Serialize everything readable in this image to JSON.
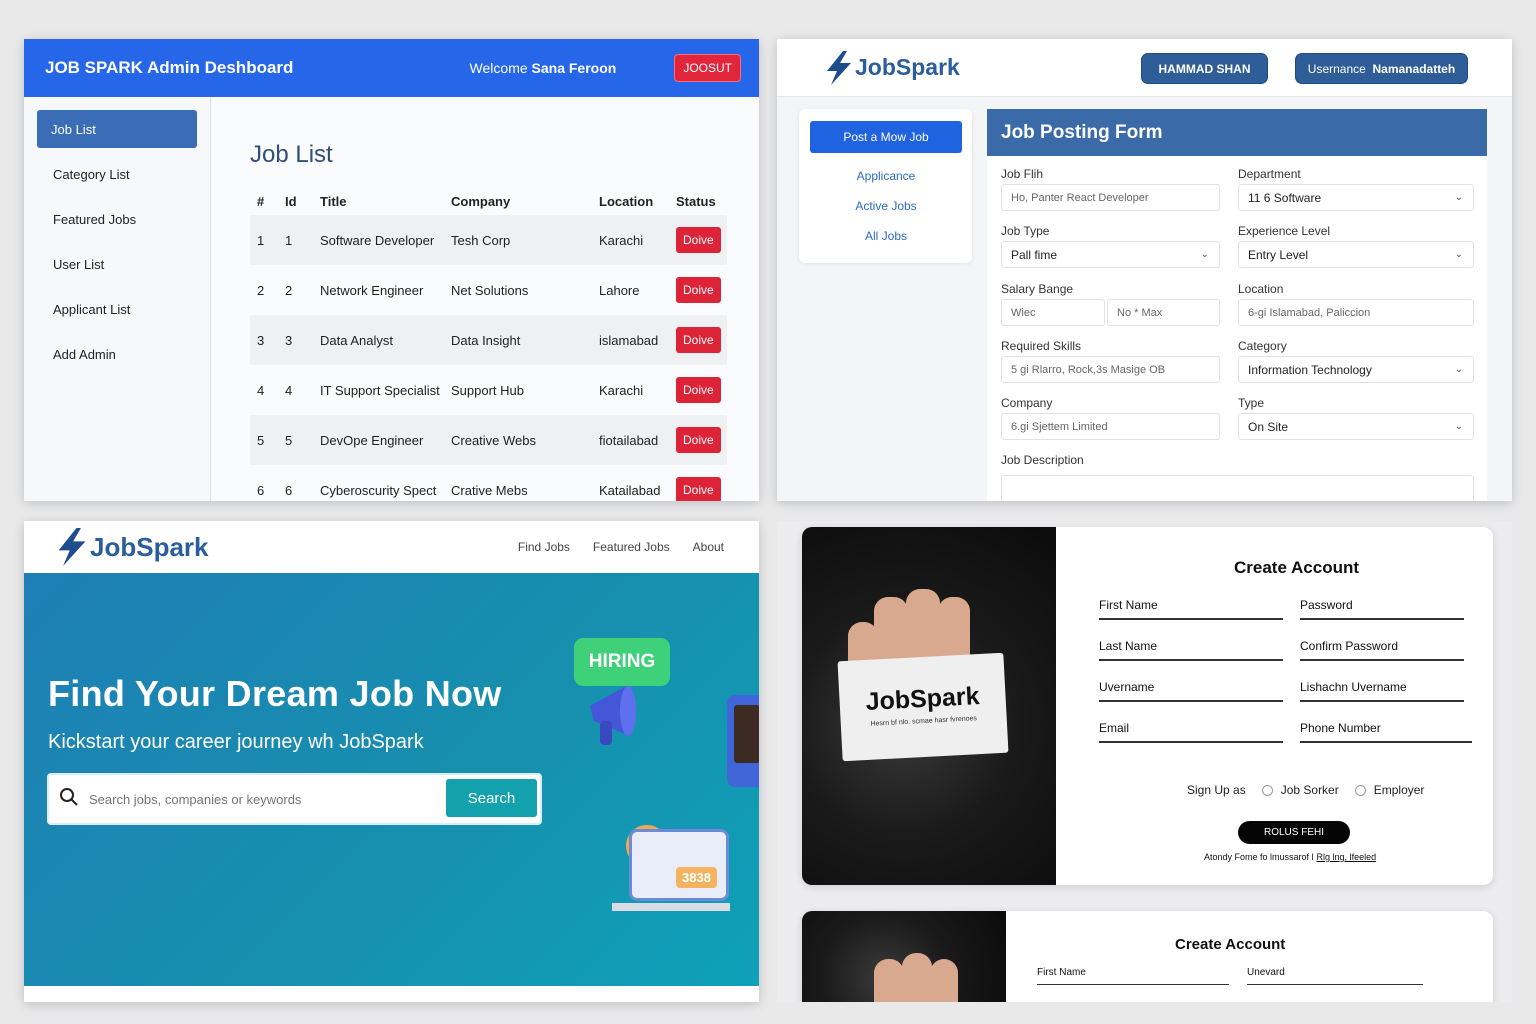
{
  "admin": {
    "title": "JOB SPARK Admin Deshboard",
    "welcome_prefix": "Welcome",
    "user_name": "Sana Feroon",
    "logout_label": "JOOSUT",
    "sidebar": [
      "Job List",
      "Category List",
      "Featured Jobs",
      "User List",
      "Applicant List",
      "Add Admin"
    ],
    "main_title": "Job List",
    "columns": [
      "#",
      "Id",
      "Title",
      "Company",
      "Location",
      "Status"
    ],
    "rows": [
      {
        "n": "1",
        "id": "1",
        "title": "Software Developer",
        "company": "Tesh Corp",
        "location": "Karachi",
        "status": "Doive"
      },
      {
        "n": "2",
        "id": "2",
        "title": "Network Engineer",
        "company": "Net Solutions",
        "location": "Lahore",
        "status": "Doive"
      },
      {
        "n": "3",
        "id": "3",
        "title": "Data Analyst",
        "company": "Data Insight",
        "location": "islamabad",
        "status": "Doive"
      },
      {
        "n": "4",
        "id": "4",
        "title": "IT Support Specialist",
        "company": "Support Hub",
        "location": "Karachi",
        "status": "Doive"
      },
      {
        "n": "5",
        "id": "5",
        "title": "DevOpe Engineer",
        "company": "Creative Webs",
        "location": "fiotailabad",
        "status": "Doive"
      },
      {
        "n": "6",
        "id": "6",
        "title": "Cyberoscurity Spect",
        "company": "Crative Mebs",
        "location": "Katailabad",
        "status": "Doive"
      }
    ],
    "colors": {
      "header": "#2567e8",
      "danger": "#dc2338",
      "active": "#3a6db5"
    }
  },
  "jobform": {
    "logo": "JobSpark",
    "user_button": "HAMMAD SHAN",
    "username_label": "Usernance",
    "username_value": "Namanadatteh",
    "post_button": "Post a Mow Job",
    "links": [
      "Applicance",
      "Active Jobs",
      "All Jobs"
    ],
    "form_title": "Job Posting Form",
    "fields": {
      "job_title": {
        "label": "Job Flih",
        "placeholder": "Ho, Panter React Developer"
      },
      "department": {
        "label": "Department",
        "value": "11 6 Software"
      },
      "job_type": {
        "label": "Job Type",
        "value": "Pall fime"
      },
      "experience": {
        "label": "Experience Level",
        "value": "Entry Level"
      },
      "salary": {
        "label": "Salary Bange",
        "min": "Wiec",
        "max": "No * Max"
      },
      "location": {
        "label": "Location",
        "placeholder": "6-gi Islamabad, Paliccion"
      },
      "skills": {
        "label": "Required Skills",
        "placeholder": "5 gi  Rlarro, Rock,3s Masige OB"
      },
      "category": {
        "label": "Category",
        "value": "Information Technology"
      },
      "company": {
        "label": "Company",
        "placeholder": "6.gi Sjettem Limited"
      },
      "type": {
        "label": "Type",
        "value": "On Site"
      },
      "description": {
        "label": "Job Description"
      }
    }
  },
  "landing": {
    "logo": "JobSpark",
    "nav": [
      "Find Jobs",
      "Featured Jobs",
      "About"
    ],
    "headline": "Find Your Dream Job Now",
    "subline": "Kickstart your career journey wh JobSpark",
    "search_placeholder": "Search jobs, companies or keywords",
    "search_button": "Search",
    "hiring_badge": "HIRING",
    "badge_number": "3838"
  },
  "signup": {
    "card_brand": "JobSpark",
    "card_tagline": "Hesrn bf nlo. scmae hasr fvrenoes",
    "title": "Create Account",
    "fields_left": [
      "First Name",
      "Last Name",
      "Uvername",
      "Email"
    ],
    "fields_right": [
      "Password",
      "Confirm Password",
      "Lishachn Uvername",
      "Phone Number"
    ],
    "signup_as": "Sign Up as",
    "roles": [
      "Job Sorker",
      "Employer"
    ],
    "register_button": "ROLUS FEHI",
    "login_prefix": "Atondy Fome fo lmussarof l",
    "login_link": "Rlg lng, lfeeled",
    "second_card": {
      "title": "Create Account",
      "field_left": "First Name",
      "field_right": "Unevard"
    }
  }
}
